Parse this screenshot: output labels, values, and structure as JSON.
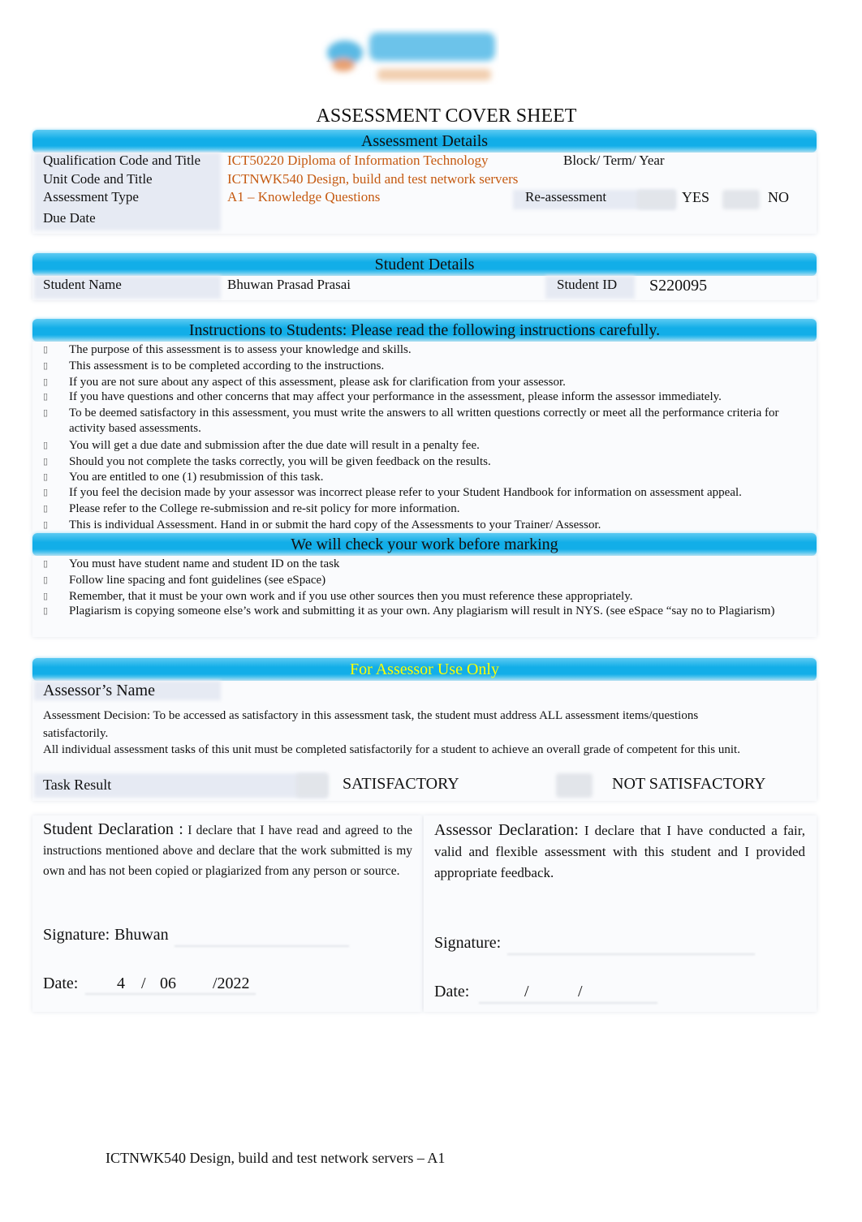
{
  "logo": {
    "text": "Skyline"
  },
  "title": "ASSESSMENT COVER SHEET",
  "assessment_details": {
    "header": "Assessment Details",
    "qualification_label": "Qualification Code and Title",
    "qualification_value": "ICT50220 Diploma of Information Technology",
    "block_label": "Block/ Term/ Year",
    "unit_label": "Unit Code and Title",
    "unit_value": "ICTNWK540 Design, build and test network servers",
    "type_label": "Assessment Type",
    "type_value": "A1 – Knowledge Questions",
    "reassessment_label": "Re-assessment",
    "yes": "YES",
    "no": "NO",
    "due_label": "Due Date"
  },
  "student_details": {
    "header": "Student Details",
    "name_label": "Student Name",
    "name_value": "Bhuwan Prasad Prasai",
    "id_label": "Student ID",
    "id_value": "S220095"
  },
  "instructions": {
    "header": "Instructions to Students:   Please read the following instructions carefully.",
    "items": [
      "The purpose of this assessment is to assess your knowledge and skills.",
      "This assessment is to be completed according to the instructions.",
      "If you are not sure about any aspect of this assessment, please ask for clarification from your assessor.",
      "If you have questions and other concerns that may affect your performance in the assessment, please inform the assessor immediately.",
      "To be deemed satisfactory in this assessment, you must write the answers to all written questions correctly or meet all the performance criteria for activity based assessments.",
      "You will get a due date and submission after the due date will result in a penalty fee.",
      "Should you not complete the tasks correctly, you will be given feedback on the results.",
      "You are entitled to one (1) resubmission of this task.",
      "If you feel the decision made by your assessor was incorrect please refer to your Student Handbook for information on assessment appeal.",
      "Please refer to the College re-submission and re-sit policy for more information.",
      "This is individual Assessment. Hand in or submit the hard copy of the Assessments to your Trainer/ Assessor."
    ]
  },
  "check": {
    "header": "We will check your work before marking",
    "items": [
      "You must have student name and student ID on the task",
      "Follow line spacing and font guidelines (see eSpace)",
      "Remember, that it must be your own work and if you use other sources then you must reference these appropriately.",
      "Plagiarism is copying someone else’s work and submitting it as your own. Any plagiarism will result in NYS. (see eSpace “say no to Plagiarism)"
    ]
  },
  "assessor": {
    "header": "For Assessor Use Only",
    "header_color": "#ffff00",
    "name_label": "Assessor’s Name",
    "decision": "Assessment Decision: To be accessed as satisfactory in this assessment task, the student must address ALL assessment items/questions satisfactorily.",
    "note": "All individual assessment tasks of this unit must be completed satisfactorily for a student to achieve an overall grade of competent for this unit.",
    "result_label": "Task Result",
    "satisfactory": "SATISFACTORY",
    "not_satisfactory": "NOT SATISFACTORY"
  },
  "student_declaration": {
    "heading": "Student Declaration :",
    "text": "I declare that I have read and agreed to the instructions mentioned above and declare that the work submitted is my own and has not been copied or plagiarized from any person or source.",
    "signature_label": "Signature:",
    "signature_value": "Bhuwan",
    "date_label": "Date:",
    "day": "4",
    "month": "06",
    "year": "/2022",
    "sep": "/"
  },
  "assessor_declaration": {
    "heading": "Assessor Declaration:",
    "text": "I declare that I have conducted a fair, valid and flexible assessment with this student and I provided appropriate feedback.",
    "signature_label": "Signature:",
    "date_label": "Date:",
    "sep": "/"
  },
  "footer": "ICTNWK540 Design, build and test network servers – A1",
  "colors": {
    "header_blue": "#12aee8",
    "value_orange": "#c55a11"
  }
}
